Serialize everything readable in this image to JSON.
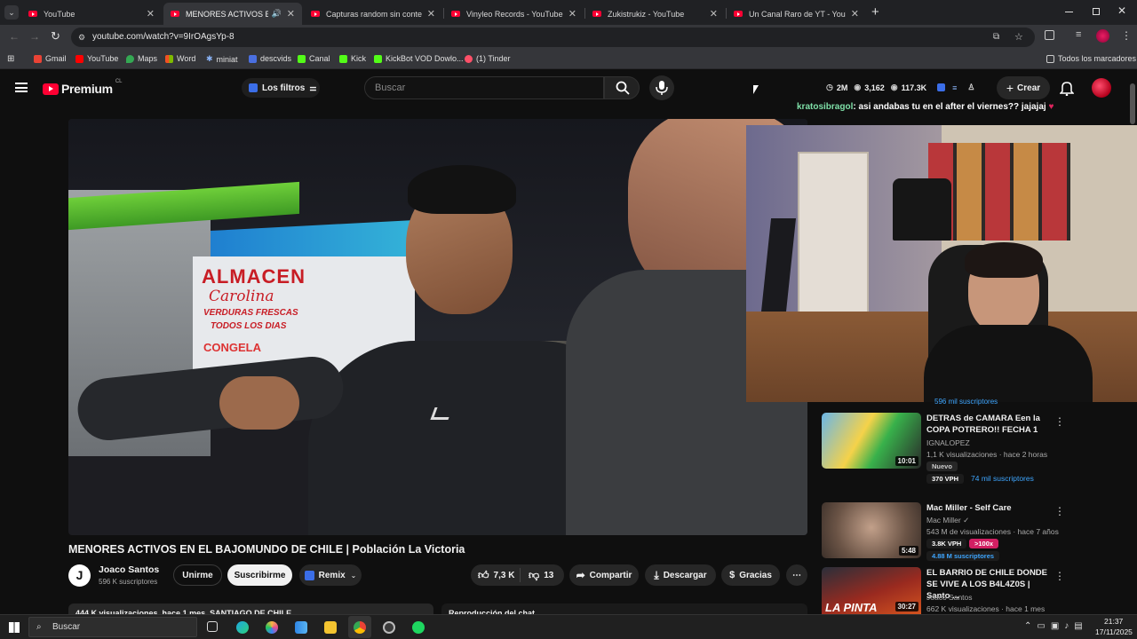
{
  "browser": {
    "tabs": [
      {
        "title": "YouTube",
        "active": false
      },
      {
        "title": "MENORES ACTIVOS EN EL B",
        "active": true
      },
      {
        "title": "Capturas random sin contexto",
        "active": false
      },
      {
        "title": "Vinyleo Records - YouTube",
        "active": false
      },
      {
        "title": "Zukistrukiz - YouTube",
        "active": false
      },
      {
        "title": "Un Canal Raro de YT - YouTube",
        "active": false
      }
    ],
    "close_glyph": "✕",
    "new_tab_glyph": "+",
    "url": "youtube.com/watch?v=9IrOAgsYp-8",
    "bookmarks": [
      "Gmail",
      "YouTube",
      "Maps",
      "Word",
      "miniat",
      "descvids",
      "Canal",
      "Kick",
      "KickBot VOD Dowlo...",
      "(1) Tinder"
    ],
    "all_bookmarks": "Todos los marcadores"
  },
  "youtube": {
    "logo": "Premium",
    "region": "CL",
    "filters_label": "Los filtros",
    "search_placeholder": "Buscar",
    "stats": {
      "a": "2M",
      "b": "3,162",
      "c": "117.3K"
    },
    "create_label": "Crear"
  },
  "chat_overlay": {
    "user": "kratosibragol",
    "message": ": asi andabas tu en el after el viernes?? jajajaj"
  },
  "video": {
    "title": "MENORES ACTIVOS EN EL BAJOMUNDO DE CHILE | Población La Victoria",
    "channel": "Joaco Santos",
    "channel_initial": "J",
    "subscribers": "596 K suscriptores",
    "join_label": "Unirme",
    "subscribe_label": "Suscribirme",
    "remix_label": "Remix",
    "likes": "7,3 K",
    "dislikes": "13",
    "share_label": "Compartir",
    "download_label": "Descargar",
    "thanks_label": "Gracias",
    "views_line": "444 K visualizaciones  hace 1 mes  SANTIAGO DE CHILE",
    "chat_replay": "Reproducción del chat",
    "store_signs": {
      "almacen": "ALMACEN",
      "carolina": "Carolina",
      "verduras": "VERDURAS FRESCAS",
      "todos": "TODOS LOS DIAS",
      "congela": "CONGELA"
    }
  },
  "recommended": [
    {
      "title": "DETRAS de CAMARA Een la COPA POTRERO!! FECHA 1",
      "channel": "IGNALOPEZ",
      "meta": "1,1 K visualizaciones · hace 2 horas",
      "badge": "Nuevo",
      "vph": "370 VPH",
      "subs": "74 mil suscriptores",
      "duration": "10:01"
    },
    {
      "title": "Mac Miller - Self Care",
      "channel": "Mac Miller",
      "meta": "543 M de visualizaciones · hace 7 años",
      "vph": "3.8K VPH",
      "ratio": ">100x",
      "subs": "4.88 M suscriptores",
      "duration": "5:48"
    },
    {
      "title": "EL BARRIO DE CHILE DONDE SE VIVE A LOS B4L4Z0S | Santo ...",
      "channel": "Joaco Santos",
      "meta": "662 K visualizaciones · hace 1 mes",
      "duration": "30:27",
      "thumb_text": "LA PINTA"
    }
  ],
  "partial_subs": "596 mil suscriptores",
  "taskbar": {
    "search": "Buscar",
    "time": "21:37",
    "date": "17/11/2025"
  },
  "colors": {
    "youtube_red": "#ff0033",
    "accent_blue": "#3ea6ff",
    "background": "#0f0f0f"
  }
}
